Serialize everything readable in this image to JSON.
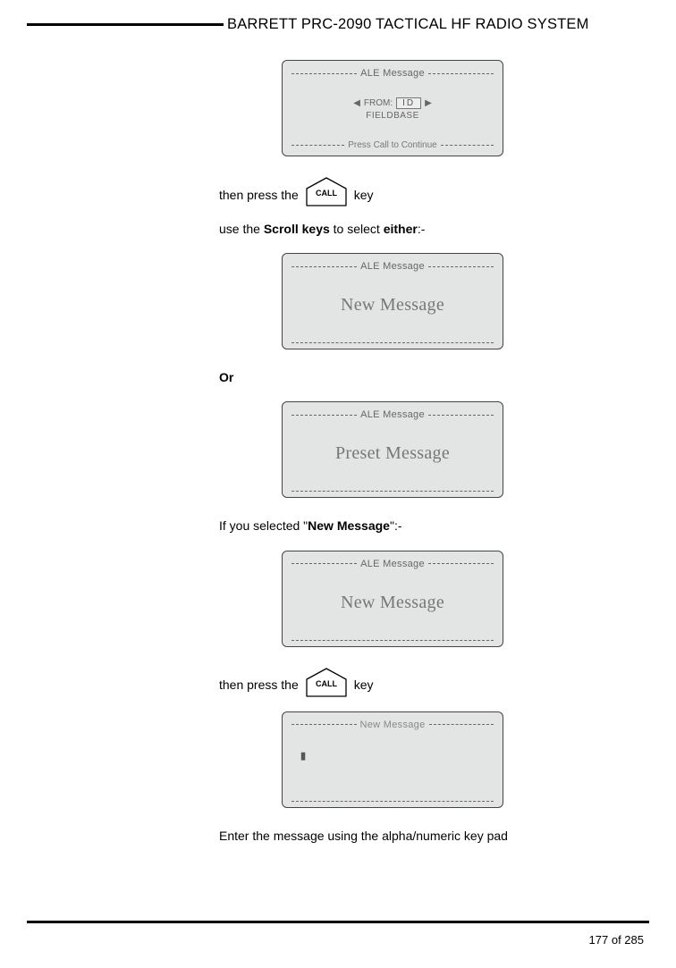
{
  "header": {
    "title": "BARRETT PRC-2090 TACTICAL HF RADIO SYSTEM"
  },
  "screens": {
    "s1_title": "ALE Message",
    "s1_from_label": "FROM:",
    "s1_from_value": "ID",
    "s1_fieldbase": "FIELDBASE",
    "s1_footer": "Press Call to Continue",
    "s2_title": "ALE Message",
    "s2_big": "New Message",
    "s3_title": "ALE Message",
    "s3_big": "Preset Message",
    "s4_title": "ALE Message",
    "s4_big": "New Message",
    "s5_title": "New Message",
    "s5_cursor": "▮"
  },
  "body": {
    "line1_a": "then press the",
    "line1_b": "key",
    "call_label": "CALL",
    "line2_a": "use the ",
    "line2_b": "Scroll keys",
    "line2_c": " to select ",
    "line2_d": "either",
    "line2_e": ":-",
    "or": "Or",
    "line3_a": "If you selected \"",
    "line3_b": "New Message",
    "line3_c": "\":-",
    "line4_a": "then press the ",
    "line4_b": "key",
    "line5": "Enter the message using the alpha/numeric key pad"
  },
  "footer": {
    "page": "177 of 285"
  }
}
